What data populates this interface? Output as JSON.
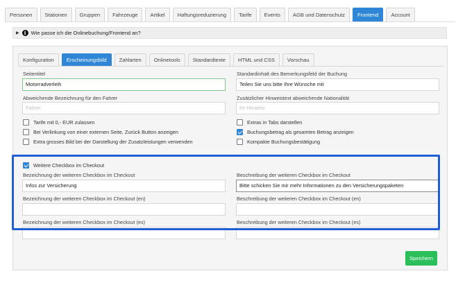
{
  "top_tabs": [
    "Personen",
    "Stationen",
    "Gruppen",
    "Fahrzeuge",
    "Artikel",
    "Haftungsreduzierung",
    "Tarife",
    "Events",
    "AGB und Datenschutz",
    "Frontend",
    "Account"
  ],
  "info_bar": {
    "text": "Wie passe ich die Onlinebuchung/Frontend an?"
  },
  "sub_tabs": [
    "Konfiguration",
    "Erscheinungsbild",
    "Zahlarten",
    "Onlinetools",
    "Standardtexte",
    "HTML und CSS",
    "Vorschau"
  ],
  "form": {
    "seitentitel": {
      "label": "Seitentitel",
      "value": "Motorradverleih"
    },
    "standardinhalt": {
      "label": "Standardinhalt des Bemerkungsfeld der Buchung",
      "value": "Teilen Sie uns bitte Ihre Wünsche mit"
    },
    "fahrer": {
      "label": "Abweichende Bezeichnung für den Fahrer",
      "placeholder": "Fahrer"
    },
    "nationalitaet": {
      "label": "Zusätzlicher Hinweistext abweichende Nationalität",
      "placeholder": "Ihr Hinweis"
    },
    "checkboxes_left": [
      {
        "label": "Tarife mit 0,- EUR zulassen",
        "checked": false
      },
      {
        "label": "Bei Verlinkung von einer externen Seite, Zurück Button anzeigen",
        "checked": false
      },
      {
        "label": "Extra grosses Bild bei der Darstellung der Zusatzleistungen verwenden",
        "checked": false
      }
    ],
    "checkboxes_right": [
      {
        "label": "Extras in Tabs darstellen",
        "checked": false
      },
      {
        "label": "Buchungsbetrag als gesamten Betrag anzeigen",
        "checked": true
      },
      {
        "label": "Kompakte Buchungsbestätigung",
        "checked": false
      }
    ],
    "weitere_checkbox": {
      "label": "Weitere Checkbox im Checkout",
      "checked": true
    },
    "bez_de": {
      "label": "Bezeichnung der weiteren Checkbox im Checkout",
      "value": "Infos zur Versicherung"
    },
    "beschr_de": {
      "label": "Beschreibung der weiteren Checkbox im Checkout",
      "value": "Bitte schicken Sie mir mehr Informationen zu den Versicherungspaketen"
    },
    "bez_en": {
      "label": "Bezeichnung der weiteren Checkbox im Checkout (en)",
      "value": ""
    },
    "beschr_en": {
      "label": "Beschreibung der weiteren Checkbox im Checkout (en)",
      "value": ""
    },
    "bez_es": {
      "label": "Bezeichnung der weiteren Checkbox im Checkout (es)",
      "value": ""
    },
    "beschr_es": {
      "label": "Beschreibung der weiteren Checkbox im Checkout (es)",
      "value": ""
    }
  },
  "save_button": "Speichern",
  "colors": {
    "accent": "#2f86d6",
    "save": "#2bbf5b",
    "highlight": "#1f5fd6"
  }
}
